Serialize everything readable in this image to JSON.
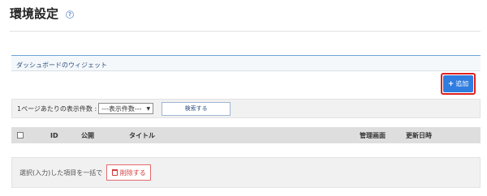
{
  "page": {
    "title": "環境設定",
    "help_icon": "?"
  },
  "section": {
    "title": "ダッシュボードのウィジェット"
  },
  "add_button": {
    "icon": "+",
    "label": "追加"
  },
  "filter": {
    "per_page_label": "1ページあたりの表示件数 :",
    "per_page_value": "---表示件数---",
    "search_label": "検索する"
  },
  "table": {
    "columns": [
      "ID",
      "公開",
      "タイトル",
      "管理画面",
      "更新日時"
    ]
  },
  "footer": {
    "bulk_label": "選択(入力)した項目を一括で",
    "delete_label": "削除する"
  },
  "colors": {
    "accent": "#2f7de1",
    "highlight": "#e02020",
    "danger": "#d63a3a"
  }
}
